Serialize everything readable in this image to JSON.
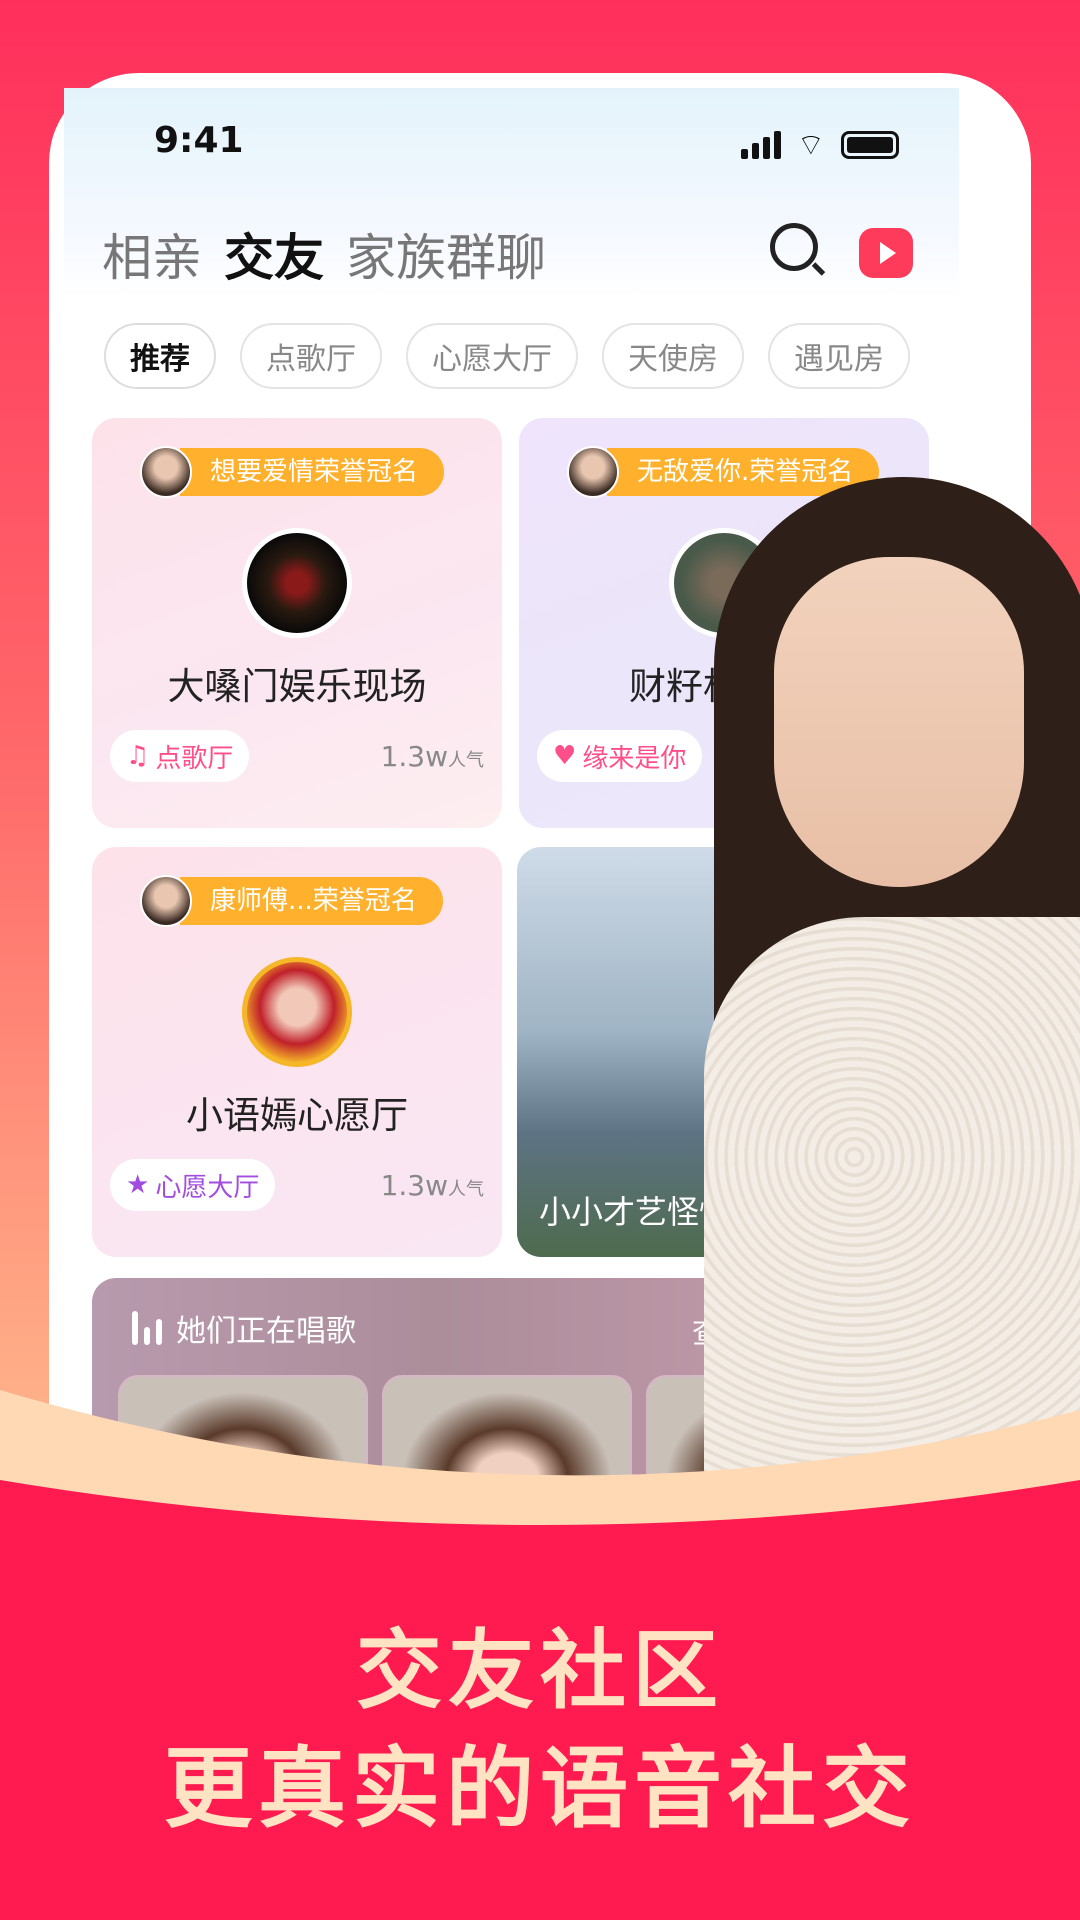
{
  "status_bar": {
    "time": "9:41"
  },
  "top_tabs": [
    {
      "label": "相亲"
    },
    {
      "label": "交友",
      "active": true
    },
    {
      "label": "家族群聊"
    }
  ],
  "header_icons": [
    "search-icon",
    "live-tv-icon"
  ],
  "chips": [
    {
      "label": "推荐",
      "active": true
    },
    {
      "label": "点歌厅"
    },
    {
      "label": "心愿大厅"
    },
    {
      "label": "天使房"
    },
    {
      "label": "遇见房"
    }
  ],
  "rooms": [
    {
      "crown": "想要爱情荣誉冠名",
      "title": "大嗓门娱乐现场",
      "tag": "点歌厅",
      "tag_icon": "music-note-icon",
      "popularity": "1.3w",
      "pop_unit": "人气"
    },
    {
      "crown": "无敌爱你.荣誉冠名",
      "title": "财籽相",
      "tag": "缘来是你",
      "tag_icon": "heart-icon"
    },
    {
      "crown": "康师傅...荣誉冠名",
      "title": "小语嫣心愿厅",
      "tag": "心愿大厅",
      "tag_icon": "star-icon",
      "popularity": "1.3w",
      "pop_unit": "人气"
    },
    {
      "title": "小小才艺怪怪"
    }
  ],
  "singing": {
    "title": "她们正在唱歌",
    "more": "查"
  },
  "promo": {
    "line1": "交友社区",
    "line2": "更真实的语音社交"
  },
  "colors": {
    "brand": "#ff1a4f",
    "crown_badge": "#ffb12d",
    "tag_pink": "#ff4f8b",
    "promo_text": "#ffe3c2"
  }
}
